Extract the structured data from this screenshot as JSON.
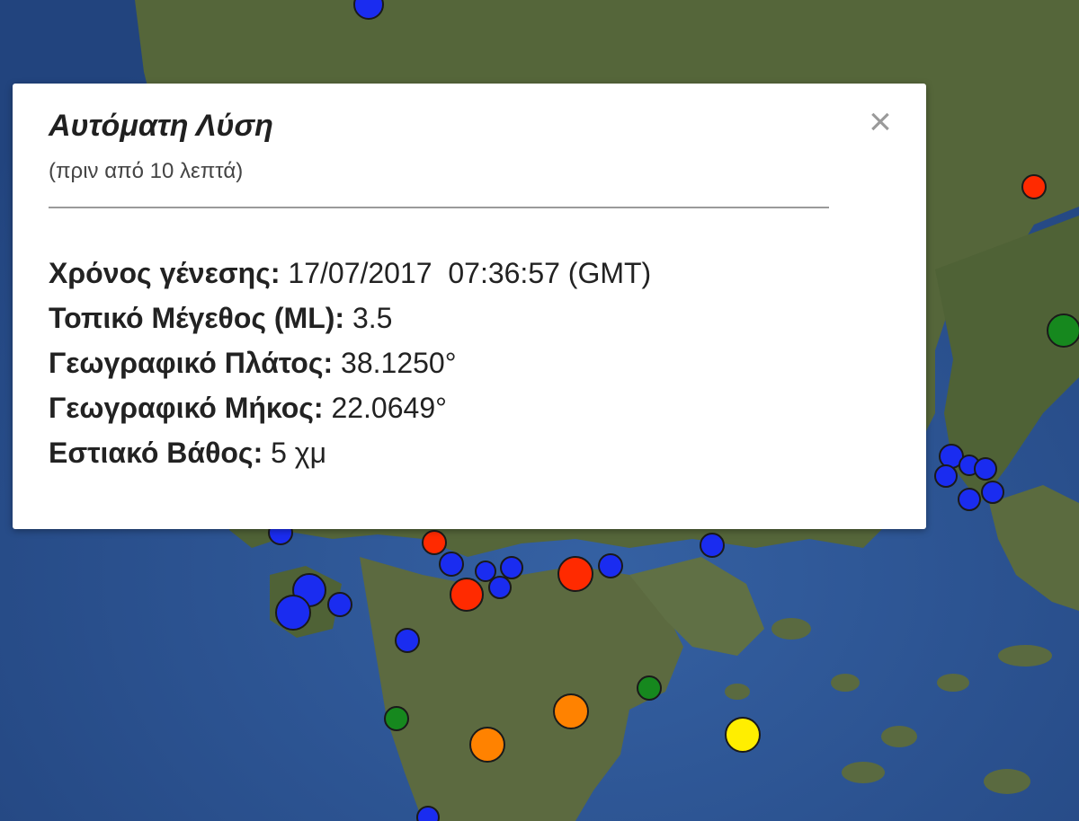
{
  "popup": {
    "title": "Αυτόματη Λύση",
    "subtitle": "(πριν από 10 λεπτά)",
    "close_symbol": "×",
    "fields": [
      {
        "label": "Χρόνος γένεσης:",
        "value": "17/07/2017  07:36:57 (GMT)"
      },
      {
        "label": "Τοπικό Μέγεθος (ML):",
        "value": "3.5"
      },
      {
        "label": "Γεωγραφικό Πλάτος:",
        "value": "38.1250°"
      },
      {
        "label": "Γεωγραφικό Μήκος:",
        "value": "22.0649°"
      },
      {
        "label": "Εστιακό Βάθος:",
        "value": "5 χμ"
      }
    ]
  },
  "colors": {
    "sea": "#2a4f8e",
    "land": "#56663a",
    "marker_red": "#ff2a00",
    "marker_orange": "#ff8200",
    "marker_blue": "#1a2cf0",
    "marker_green": "#16881e",
    "marker_yellow": "#ffee00"
  },
  "icons": {
    "close": "close-icon",
    "marker": "earthquake-marker"
  }
}
